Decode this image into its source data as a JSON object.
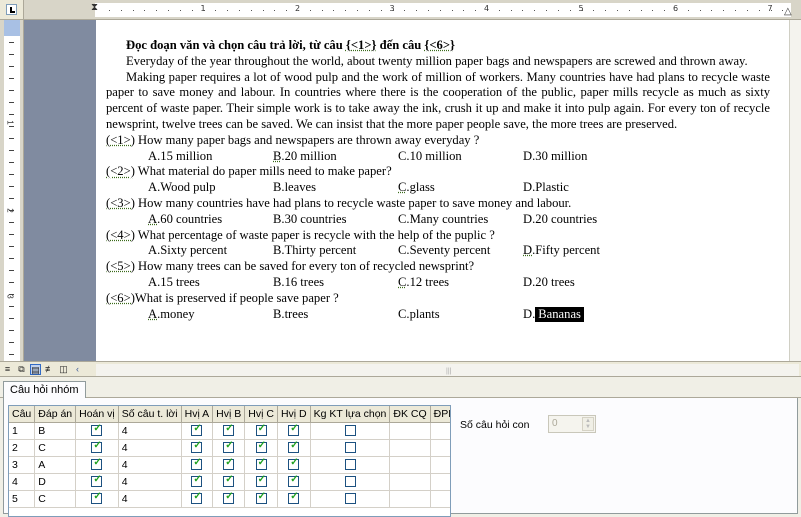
{
  "ruler": {
    "numbers": [
      "1",
      "2",
      "3",
      "4",
      "5",
      "6",
      "7"
    ],
    "vnumbers": [
      "1",
      "2",
      "3"
    ]
  },
  "document": {
    "title_pre": "Đọc đoạn văn và chọn câu trả lời, từ câu ",
    "title_from": "{<1>}",
    "title_mid": " đến câu ",
    "title_to": "{<6>}",
    "para1": "Everyday of the year throughout the world, about twenty million paper bags and newspapers are screwed and thrown away.",
    "para2": "Making paper requires a lot of wood pulp and the work of million of workers. Many countries have had plans to recycle waste paper to save money and labour. In countries where there is the cooperation of the public, paper mills recycle as much as sixty percent of waste paper. Their simple work is to take away the ink, crush it up and make it into pulp again. For every ton  of recycle newsprint, twelve trees can be saved. We can insist that the more paper people save, the more trees are preserved.",
    "questions": [
      {
        "tag": "(<1>)",
        "text": " How many paper bags and newspapers  are thrown away everyday ?",
        "answers": [
          {
            "letter": "A",
            "text": " 15 million",
            "underlined": false
          },
          {
            "letter": "B",
            "text": " 20 million",
            "underlined": true
          },
          {
            "letter": "C",
            "text": " 10 million",
            "underlined": false
          },
          {
            "letter": "D",
            "text": " 30 million",
            "underlined": false
          }
        ]
      },
      {
        "tag": "(<2>)",
        "text": " What material do paper mills need to make paper?",
        "answers": [
          {
            "letter": "A",
            "text": " Wood pulp",
            "underlined": false
          },
          {
            "letter": "B",
            "text": " leaves",
            "underlined": false
          },
          {
            "letter": "C",
            "text": " glass",
            "underlined": true
          },
          {
            "letter": "D",
            "text": " Plastic",
            "underlined": false
          }
        ]
      },
      {
        "tag": "(<3>)",
        "text": " How many countries have had plans to recycle waste paper to save money and labour.",
        "answers": [
          {
            "letter": "A",
            "text": " 60 countries",
            "underlined": true
          },
          {
            "letter": "B",
            "text": " 30 countries",
            "underlined": false
          },
          {
            "letter": "C",
            "text": " Many countries",
            "underlined": false
          },
          {
            "letter": "D",
            "text": "20 countries",
            "underlined": false
          }
        ]
      },
      {
        "tag": "(<4>)",
        "text": " What percentage of waste paper is recycle with the help of the puplic ?",
        "answers": [
          {
            "letter": "A",
            "text": " Sixty percent",
            "underlined": false
          },
          {
            "letter": "B",
            "text": "  Thirty percent",
            "underlined": false
          },
          {
            "letter": "C",
            "text": " Seventy percent",
            "underlined": false
          },
          {
            "letter": "D",
            "text": "Fifty percent",
            "underlined": true
          }
        ]
      },
      {
        "tag": "(<5>)",
        "text": " How many trees can be saved for every ton of recycled newsprint?",
        "answers": [
          {
            "letter": "A",
            "text": " 15 trees",
            "underlined": false
          },
          {
            "letter": "B",
            "text": " 16 trees",
            "underlined": false
          },
          {
            "letter": "C",
            "text": " 12 trees",
            "underlined": true
          },
          {
            "letter": "D",
            "text": " 20 trees",
            "underlined": false
          }
        ]
      },
      {
        "tag": "(<6>)",
        "text": "What is preserved if people save paper ?",
        "answers": [
          {
            "letter": "A",
            "text": " money",
            "underlined": true
          },
          {
            "letter": "B",
            "text": " trees",
            "underlined": false
          },
          {
            "letter": "C",
            "text": " plants",
            "underlined": false
          },
          {
            "letter": "D",
            "text": " Bananas",
            "underlined": false,
            "selected": true
          }
        ]
      }
    ]
  },
  "panel": {
    "tab_label": "Câu hỏi nhóm",
    "columns": [
      "Câu",
      "Đáp án",
      "Hoán vị",
      "Số câu t. lời",
      "Hvị A",
      "Hvị B",
      "Hvị C",
      "Hvị D",
      "Kg KT lựa chọn",
      "ĐK CQ",
      "ĐPB CQ"
    ],
    "rows": [
      {
        "cau": "1",
        "dap_an": "B",
        "hoan_vi": true,
        "so_cau": "4",
        "a": true,
        "b": true,
        "c": true,
        "d": true,
        "kgkt": false
      },
      {
        "cau": "2",
        "dap_an": "C",
        "hoan_vi": true,
        "so_cau": "4",
        "a": true,
        "b": true,
        "c": true,
        "d": true,
        "kgkt": false
      },
      {
        "cau": "3",
        "dap_an": "A",
        "hoan_vi": true,
        "so_cau": "4",
        "a": true,
        "b": true,
        "c": true,
        "d": true,
        "kgkt": false
      },
      {
        "cau": "4",
        "dap_an": "D",
        "hoan_vi": true,
        "so_cau": "4",
        "a": true,
        "b": true,
        "c": true,
        "d": true,
        "kgkt": false
      },
      {
        "cau": "5",
        "dap_an": "C",
        "hoan_vi": true,
        "so_cau": "4",
        "a": true,
        "b": true,
        "c": true,
        "d": true,
        "kgkt": false
      }
    ],
    "sub_count_label": "Số câu hỏi con",
    "sub_count_value": "0"
  }
}
